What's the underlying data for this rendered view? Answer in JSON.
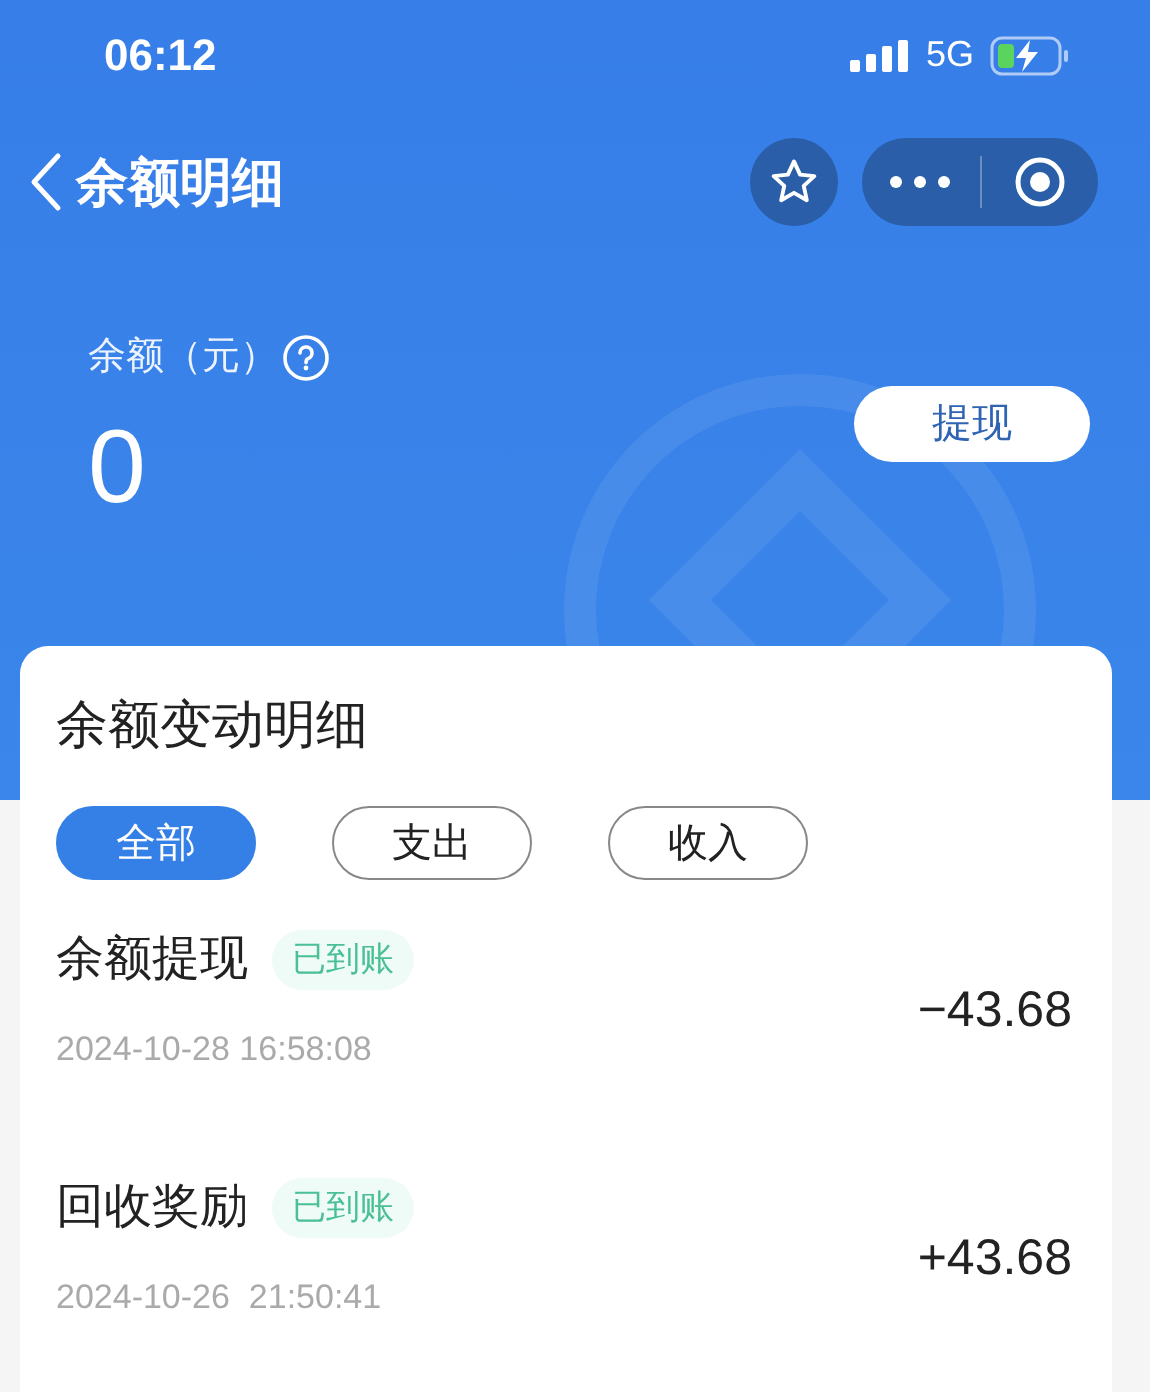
{
  "status_bar": {
    "time": "06:12",
    "network": "5G"
  },
  "nav": {
    "title": "余额明细"
  },
  "balance": {
    "label": "余额（元）",
    "amount": "0",
    "withdraw_button": "提现"
  },
  "details": {
    "title": "余额变动明细",
    "filters": [
      {
        "label": "全部",
        "selected": true
      },
      {
        "label": "支出",
        "selected": false
      },
      {
        "label": "收入",
        "selected": false
      }
    ],
    "records": [
      {
        "title": "余额提现",
        "status": "已到账",
        "time": "2024-10-28 16:58:08",
        "amount": "−43.68"
      },
      {
        "title": "回收奖励",
        "status": "已到账",
        "time": "2024-10-26  21:50:41",
        "amount": "+43.68"
      }
    ]
  }
}
